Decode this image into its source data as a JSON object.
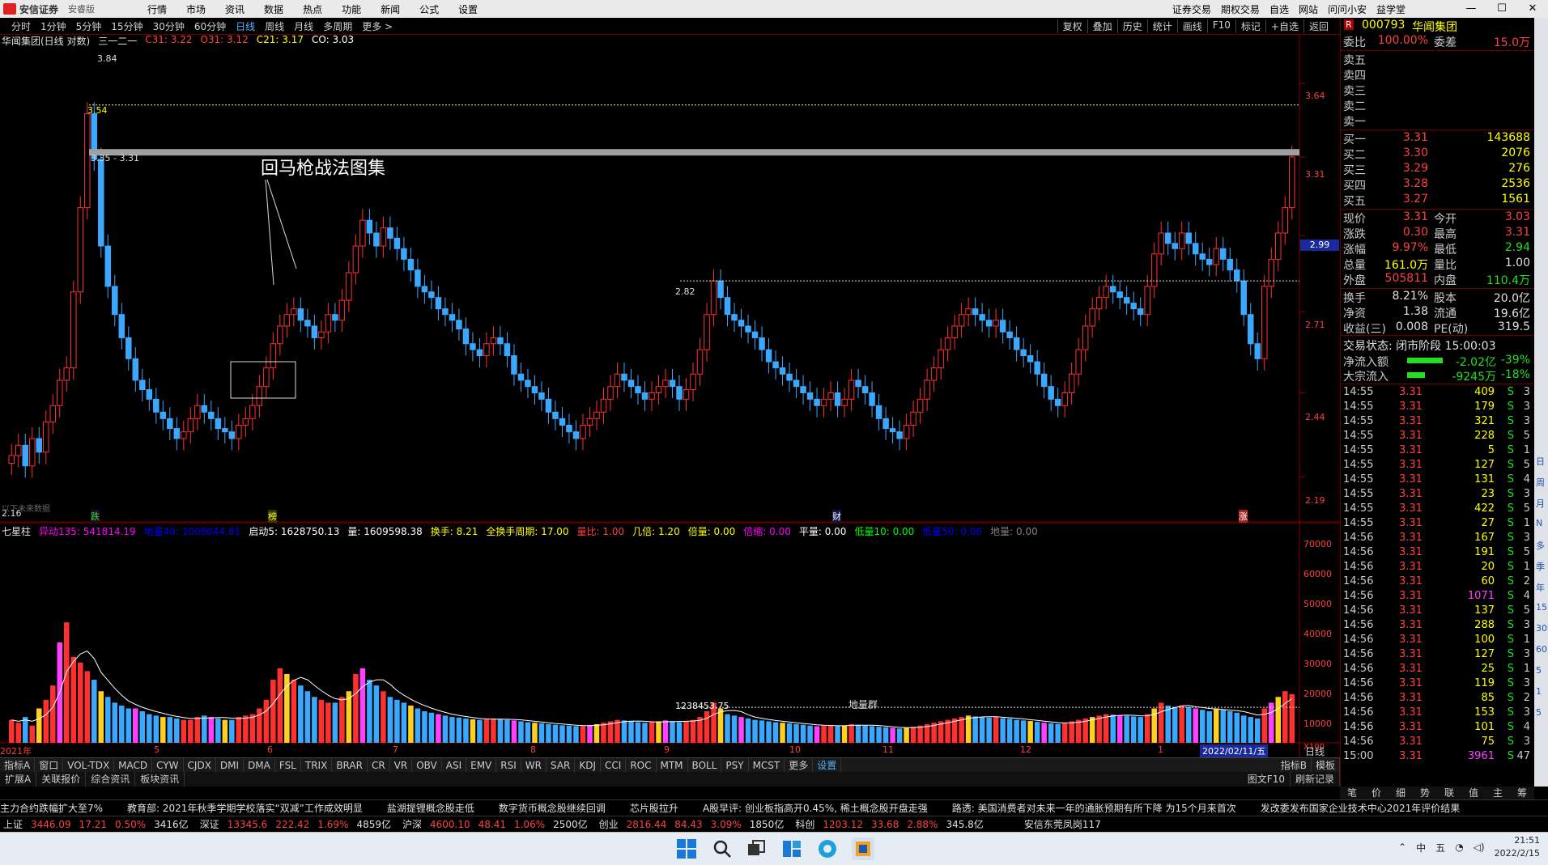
{
  "topbar": {
    "brand": "安信证券",
    "edition": "安睿版",
    "menu": [
      "行情",
      "市场",
      "资讯",
      "数据",
      "热点",
      "功能",
      "新闻",
      "公式",
      "设置"
    ],
    "right_links": [
      "证券交易",
      "期权交易",
      "自选",
      "网站",
      "问问小安",
      "益学堂"
    ],
    "window_controls": [
      "—",
      "☐",
      "✕"
    ]
  },
  "periodbar": {
    "periods": [
      "分时",
      "1分钟",
      "5分钟",
      "15分钟",
      "30分钟",
      "60分钟",
      "日线",
      "周线",
      "月线",
      "多周期",
      "更多 >"
    ],
    "active": "日线",
    "tools": [
      "复权",
      "叠加",
      "历史",
      "统计",
      "画线",
      "F10",
      "标记",
      "+自选",
      "返回"
    ]
  },
  "main_chart": {
    "title": "华闻集团(日线 对数)",
    "indicator": "三一二一",
    "ma_labels": [
      {
        "text": "C31: 3.22",
        "color": "#ff4040"
      },
      {
        "text": "O31: 3.12",
        "color": "#ff4040"
      },
      {
        "text": "C21: 3.17",
        "color": "#ffff00"
      },
      {
        "text": "CO: 3.03",
        "color": "#ffffff"
      }
    ],
    "annotation": "回马枪战法图集",
    "band_label": "3.35 - 3.31",
    "level_label_354": "3.54",
    "peak_label": "3.84",
    "level_label_282": "2.82",
    "low_label": "2.16",
    "current_price_tag": "2.99",
    "y_ticks": [
      "3.64",
      "3.31",
      "2.99",
      "2.71",
      "2.44",
      "2.19"
    ],
    "markers": [
      "跌",
      "榜",
      "财",
      "涨"
    ],
    "watermark": "以下未来数据"
  },
  "vol_chart": {
    "title": "七星柱",
    "legend": [
      {
        "text": "异动135: 541814.19",
        "color": "#ff00ff"
      },
      {
        "text": "地量40: 1008044.81",
        "color": "#0000ff"
      },
      {
        "text": "启动5: 1628750.13",
        "color": "#ffffff"
      },
      {
        "text": "量: 1609598.38",
        "color": "#ffffff"
      },
      {
        "text": "换手: 8.21",
        "color": "#ffff00"
      },
      {
        "text": "全换手周期: 17.00",
        "color": "#ffff00"
      },
      {
        "text": "量比: 1.00",
        "color": "#ff4040"
      },
      {
        "text": "几倍: 1.20",
        "color": "#ffff00"
      },
      {
        "text": "倍量: 0.00",
        "color": "#ffff00"
      },
      {
        "text": "倍缩: 0.00",
        "color": "#ff00ff"
      },
      {
        "text": "平量: 0.00",
        "color": "#ffffff"
      },
      {
        "text": "低量10: 0.00",
        "color": "#00ff00"
      },
      {
        "text": "低量50: 0.00",
        "color": "#0000ff"
      },
      {
        "text": "地量: 0.00",
        "color": "#808080"
      }
    ],
    "y_ticks": [
      "70000",
      "60000",
      "50000",
      "40000",
      "30000",
      "20000",
      "10000"
    ],
    "unit": "X100",
    "mark_value": "1238453.75",
    "mark_label": "地量群",
    "x_labels": [
      "2021年",
      "5",
      "6",
      "7",
      "8",
      "9",
      "10",
      "11",
      "12",
      "1"
    ],
    "date_box": "2022/02/11/五",
    "period_label": "日线"
  },
  "indicator_tabs": [
    "指标A",
    "窗口",
    "VOL-TDX",
    "MACD",
    "CYW",
    "CJDX",
    "DMI",
    "DMA",
    "FSL",
    "TRIX",
    "BRAR",
    "CR",
    "VR",
    "OBV",
    "ASI",
    "EMV",
    "RSI",
    "WR",
    "SAR",
    "KDJ",
    "CCI",
    "ROC",
    "MTM",
    "BOLL",
    "PSY",
    "MCST",
    "更多",
    "设置"
  ],
  "indicator_tabs_right": [
    "指标B",
    "模板"
  ],
  "sub_tabs": [
    "扩展A",
    "关联报价",
    "综合资讯",
    "板块资讯"
  ],
  "sub_tabs_right": [
    "图文F10",
    "刷新记录"
  ],
  "quote": {
    "code": "000793",
    "name": "华闻集团",
    "webi_label": "委比",
    "webi": "100.00%",
    "weicha_label": "委差",
    "weicha": "15.0万",
    "sell": [
      {
        "label": "卖五",
        "price": "",
        "vol": ""
      },
      {
        "label": "卖四",
        "price": "",
        "vol": ""
      },
      {
        "label": "卖三",
        "price": "",
        "vol": ""
      },
      {
        "label": "卖二",
        "price": "",
        "vol": ""
      },
      {
        "label": "卖一",
        "price": "",
        "vol": ""
      }
    ],
    "buy": [
      {
        "label": "买一",
        "price": "3.31",
        "vol": "143688"
      },
      {
        "label": "买二",
        "price": "3.30",
        "vol": "2076"
      },
      {
        "label": "买三",
        "price": "3.29",
        "vol": "276"
      },
      {
        "label": "买四",
        "price": "3.28",
        "vol": "2536"
      },
      {
        "label": "买五",
        "price": "3.27",
        "vol": "1561"
      }
    ],
    "stats": [
      {
        "l1": "现价",
        "v1": "3.31",
        "l2": "今开",
        "v2": "3.03"
      },
      {
        "l1": "涨跌",
        "v1": "0.30",
        "l2": "最高",
        "v2": "3.31"
      },
      {
        "l1": "涨幅",
        "v1": "9.97%",
        "l2": "最低",
        "v2": "2.94"
      },
      {
        "l1": "总量",
        "v1": "161.0万",
        "l2": "量比",
        "v2": "1.00"
      },
      {
        "l1": "外盘",
        "v1": "505811",
        "l2": "内盘",
        "v2": "110.4万"
      }
    ],
    "stats2": [
      {
        "l1": "换手",
        "v1": "8.21%",
        "l2": "股本",
        "v2": "20.0亿"
      },
      {
        "l1": "净资",
        "v1": "1.38",
        "l2": "流通",
        "v2": "19.6亿"
      },
      {
        "l1": "收益(三)",
        "v1": "0.008",
        "l2": "PE(动)",
        "v2": "319.5"
      }
    ],
    "trade_status": "交易状态: 闭市阶段 15:00:03",
    "flows": [
      {
        "label": "净流入额",
        "value": "-2.02亿",
        "pct": "-39%"
      },
      {
        "label": "大宗流入",
        "value": "-9245万",
        "pct": "-18%"
      }
    ]
  },
  "ticks": [
    {
      "t": "14:55",
      "p": "3.31",
      "v": "409",
      "s": "S",
      "n": "3"
    },
    {
      "t": "14:55",
      "p": "3.31",
      "v": "179",
      "s": "S",
      "n": "3"
    },
    {
      "t": "14:55",
      "p": "3.31",
      "v": "321",
      "s": "S",
      "n": "3"
    },
    {
      "t": "14:55",
      "p": "3.31",
      "v": "228",
      "s": "S",
      "n": "5"
    },
    {
      "t": "14:55",
      "p": "3.31",
      "v": "5",
      "s": "S",
      "n": "1"
    },
    {
      "t": "14:55",
      "p": "3.31",
      "v": "127",
      "s": "S",
      "n": "5"
    },
    {
      "t": "14:55",
      "p": "3.31",
      "v": "131",
      "s": "S",
      "n": "4"
    },
    {
      "t": "14:55",
      "p": "3.31",
      "v": "23",
      "s": "S",
      "n": "3"
    },
    {
      "t": "14:55",
      "p": "3.31",
      "v": "422",
      "s": "S",
      "n": "5"
    },
    {
      "t": "14:55",
      "p": "3.31",
      "v": "27",
      "s": "S",
      "n": "1"
    },
    {
      "t": "14:56",
      "p": "3.31",
      "v": "167",
      "s": "S",
      "n": "3"
    },
    {
      "t": "14:56",
      "p": "3.31",
      "v": "191",
      "s": "S",
      "n": "5"
    },
    {
      "t": "14:56",
      "p": "3.31",
      "v": "20",
      "s": "S",
      "n": "1"
    },
    {
      "t": "14:56",
      "p": "3.31",
      "v": "60",
      "s": "S",
      "n": "2"
    },
    {
      "t": "14:56",
      "p": "3.31",
      "v": "1071",
      "s": "S",
      "n": "4"
    },
    {
      "t": "14:56",
      "p": "3.31",
      "v": "137",
      "s": "S",
      "n": "5"
    },
    {
      "t": "14:56",
      "p": "3.31",
      "v": "288",
      "s": "S",
      "n": "3"
    },
    {
      "t": "14:56",
      "p": "3.31",
      "v": "100",
      "s": "S",
      "n": "1"
    },
    {
      "t": "14:56",
      "p": "3.31",
      "v": "127",
      "s": "S",
      "n": "3"
    },
    {
      "t": "14:56",
      "p": "3.31",
      "v": "25",
      "s": "S",
      "n": "1"
    },
    {
      "t": "14:56",
      "p": "3.31",
      "v": "119",
      "s": "S",
      "n": "3"
    },
    {
      "t": "14:56",
      "p": "3.31",
      "v": "85",
      "s": "S",
      "n": "2"
    },
    {
      "t": "14:56",
      "p": "3.31",
      "v": "153",
      "s": "S",
      "n": "3"
    },
    {
      "t": "14:56",
      "p": "3.31",
      "v": "101",
      "s": "S",
      "n": "4"
    },
    {
      "t": "14:56",
      "p": "3.31",
      "v": "75",
      "s": "S",
      "n": "3"
    },
    {
      "t": "15:00",
      "p": "3.31",
      "v": "3961",
      "s": "S",
      "n": "47"
    }
  ],
  "right_bottom_tabs": [
    "笔",
    "价",
    "细",
    "势",
    "联",
    "值",
    "主",
    "筹"
  ],
  "right_icons": [
    "日",
    "周",
    "月",
    "N",
    "多",
    "季",
    "年",
    "15",
    "30",
    "60",
    "5",
    "1",
    "5"
  ],
  "news": [
    "主力合约跌幅扩大至7%",
    "教育部: 2021年秋季学期学校落实“双减”工作成效明显",
    "盐湖提锂概念股走低",
    "数字货币概念股继续回调",
    "芯片股拉升",
    "A股早评: 创业板指高开0.45%, 稀土概念股开盘走强",
    "路透: 美国消费者对未来一年的通胀预期有所下降 为15个月来首次",
    "发改委发布国家企业技术中心2021年评价结果"
  ],
  "indices": [
    {
      "name": "上证",
      "price": "3446.09",
      "chg": "17.21",
      "pct": "0.50%",
      "amt": "3416亿"
    },
    {
      "name": "深证",
      "price": "13345.6",
      "chg": "222.42",
      "pct": "1.69%",
      "amt": "4859亿"
    },
    {
      "name": "沪深",
      "price": "4600.10",
      "chg": "48.41",
      "pct": "1.06%",
      "amt": "2500亿"
    },
    {
      "name": "创业",
      "price": "2816.44",
      "chg": "84.43",
      "pct": "3.09%",
      "amt": "1850亿"
    },
    {
      "name": "科创",
      "price": "1203.12",
      "chg": "33.68",
      "pct": "2.88%",
      "amt": "345.8亿"
    }
  ],
  "indexbar_extra": "安信东莞凤岗117",
  "taskbar": {
    "ime": "中",
    "ime2": "五",
    "time": "21:51",
    "date": "2022/2/15"
  },
  "chart_data": {
    "type": "candlestick",
    "title": "华闻集团(日线 对数)",
    "series_note": "daily OHLC, log scale",
    "ylim": [
      2.16,
      3.84
    ],
    "y_ticks": [
      3.64,
      3.31,
      2.99,
      2.71,
      2.44,
      2.19
    ],
    "x_labels": [
      "2021年",
      "5",
      "6",
      "7",
      "8",
      "9",
      "10",
      "11",
      "12",
      "1"
    ],
    "horizontal_levels": [
      3.54,
      3.33,
      2.82
    ],
    "closes": [
      2.25,
      2.28,
      2.22,
      2.3,
      2.26,
      2.35,
      2.4,
      2.48,
      2.52,
      2.78,
      3.1,
      3.5,
      3.3,
      2.95,
      2.8,
      2.7,
      2.62,
      2.55,
      2.48,
      2.45,
      2.42,
      2.38,
      2.36,
      2.33,
      2.3,
      2.32,
      2.36,
      2.4,
      2.38,
      2.36,
      2.33,
      2.32,
      2.3,
      2.34,
      2.36,
      2.4,
      2.46,
      2.52,
      2.6,
      2.66,
      2.7,
      2.72,
      2.68,
      2.66,
      2.62,
      2.64,
      2.7,
      2.68,
      2.75,
      2.85,
      2.95,
      3.05,
      3.0,
      2.95,
      3.02,
      2.98,
      2.94,
      2.9,
      2.86,
      2.8,
      2.78,
      2.76,
      2.72,
      2.7,
      2.68,
      2.65,
      2.6,
      2.58,
      2.56,
      2.6,
      2.62,
      2.6,
      2.56,
      2.5,
      2.48,
      2.46,
      2.44,
      2.42,
      2.38,
      2.36,
      2.34,
      2.32,
      2.3,
      2.34,
      2.36,
      2.38,
      2.42,
      2.46,
      2.5,
      2.48,
      2.46,
      2.44,
      2.42,
      2.44,
      2.46,
      2.48,
      2.46,
      2.42,
      2.45,
      2.5,
      2.58,
      2.7,
      2.82,
      2.76,
      2.7,
      2.68,
      2.66,
      2.64,
      2.62,
      2.58,
      2.54,
      2.52,
      2.5,
      2.48,
      2.46,
      2.44,
      2.42,
      2.4,
      2.42,
      2.44,
      2.4,
      2.42,
      2.48,
      2.46,
      2.44,
      2.4,
      2.36,
      2.33,
      2.32,
      2.3,
      2.34,
      2.38,
      2.42,
      2.48,
      2.52,
      2.58,
      2.62,
      2.66,
      2.7,
      2.72,
      2.7,
      2.68,
      2.66,
      2.68,
      2.64,
      2.62,
      2.58,
      2.56,
      2.54,
      2.5,
      2.46,
      2.42,
      2.4,
      2.44,
      2.5,
      2.58,
      2.66,
      2.72,
      2.76,
      2.8,
      2.78,
      2.76,
      2.74,
      2.72,
      2.7,
      2.8,
      2.92,
      3.0,
      2.96,
      2.94,
      3.0,
      2.96,
      2.92,
      2.9,
      2.88,
      2.94,
      2.9,
      2.86,
      2.82,
      2.7,
      2.6,
      2.55,
      2.8,
      2.9,
      3.0,
      3.1,
      3.31
    ],
    "volumes_x100": [
      8000,
      7000,
      9000,
      6000,
      12000,
      15000,
      20000,
      35000,
      42000,
      30000,
      28000,
      25000,
      22000,
      18000,
      16000,
      14000,
      13000,
      12000,
      12000,
      11000,
      10000,
      9500,
      9000,
      9000,
      8500,
      8000,
      8000,
      9000,
      9500,
      9000,
      8500,
      8000,
      8000,
      9000,
      9500,
      10000,
      12000,
      15000,
      22000,
      26000,
      24000,
      22000,
      20000,
      18000,
      16000,
      15000,
      14000,
      14000,
      16000,
      18000,
      24000,
      26000,
      22000,
      20000,
      18000,
      16000,
      15000,
      14000,
      13000,
      12000,
      11000,
      10500,
      10000,
      9500,
      9000,
      8800,
      8500,
      8200,
      8000,
      8200,
      8500,
      8300,
      8000,
      7800,
      7500,
      7200,
      7000,
      6800,
      6500,
      6300,
      6100,
      6000,
      5800,
      6000,
      6200,
      6500,
      7000,
      7500,
      8000,
      7800,
      7500,
      7200,
      7000,
      7200,
      7500,
      7800,
      7500,
      7200,
      7500,
      8000,
      9000,
      11000,
      14000,
      12000,
      10000,
      9500,
      9000,
      8500,
      8000,
      7800,
      7500,
      7200,
      7000,
      6800,
      6500,
      6300,
      6000,
      5800,
      6000,
      6200,
      5800,
      6000,
      6500,
      6300,
      6000,
      5800,
      5600,
      5400,
      5200,
      5000,
      5300,
      5600,
      6000,
      6500,
      7000,
      7500,
      8000,
      8500,
      9000,
      9500,
      9200,
      9000,
      8800,
      9000,
      8600,
      8400,
      8000,
      7800,
      7600,
      7300,
      7000,
      6800,
      6600,
      7000,
      7500,
      8000,
      8500,
      9000,
      9500,
      10000,
      9800,
      9600,
      9400,
      9200,
      9000,
      10000,
      12000,
      14000,
      13000,
      12500,
      13000,
      12500,
      12000,
      11500,
      11000,
      12000,
      11500,
      11000,
      10500,
      9500,
      9000,
      8500,
      12000,
      14000,
      16000,
      18000,
      17000
    ]
  }
}
